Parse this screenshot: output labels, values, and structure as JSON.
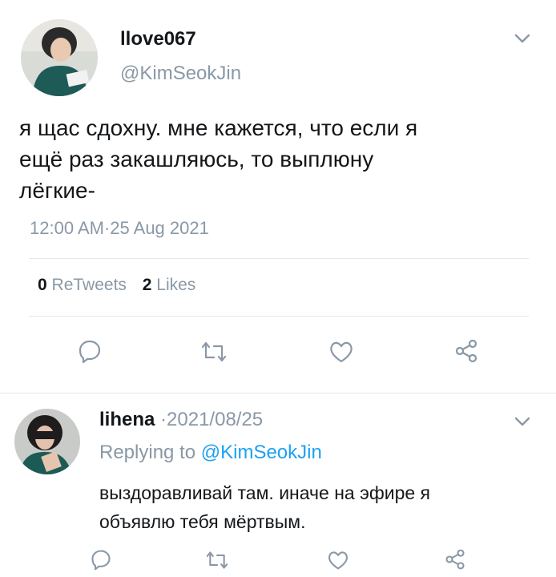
{
  "main_tweet": {
    "display_name": "llove067",
    "handle": "@KimSeokJin",
    "text_lines": [
      "я щас сдохну. мне кажется, что если я",
      "ещё раз закашляюсь, то выплюну",
      "лёгкие-"
    ],
    "time": "12:00 AM",
    "date": "25 Aug 2021",
    "retweets_count": "0",
    "retweets_label": "ReTweets",
    "likes_count": "2",
    "likes_label": "Likes",
    "actions": [
      "reply-icon",
      "retweet-icon",
      "like-icon",
      "share-icon"
    ]
  },
  "reply": {
    "display_name": "lihena",
    "date": "2021/08/25",
    "replying_prefix": "Replying to",
    "replying_handle": "@KimSeokJin",
    "text_lines": [
      "выздоравливай там. иначе на эфире я",
      "объявлю тебя мёртвым."
    ],
    "actions": [
      "reply-icon",
      "retweet-icon",
      "like-icon",
      "share-icon"
    ]
  },
  "colors": {
    "text": "#14171a",
    "muted": "#8a98a6",
    "link": "#1da1f2",
    "divider": "#e3e7ea"
  }
}
